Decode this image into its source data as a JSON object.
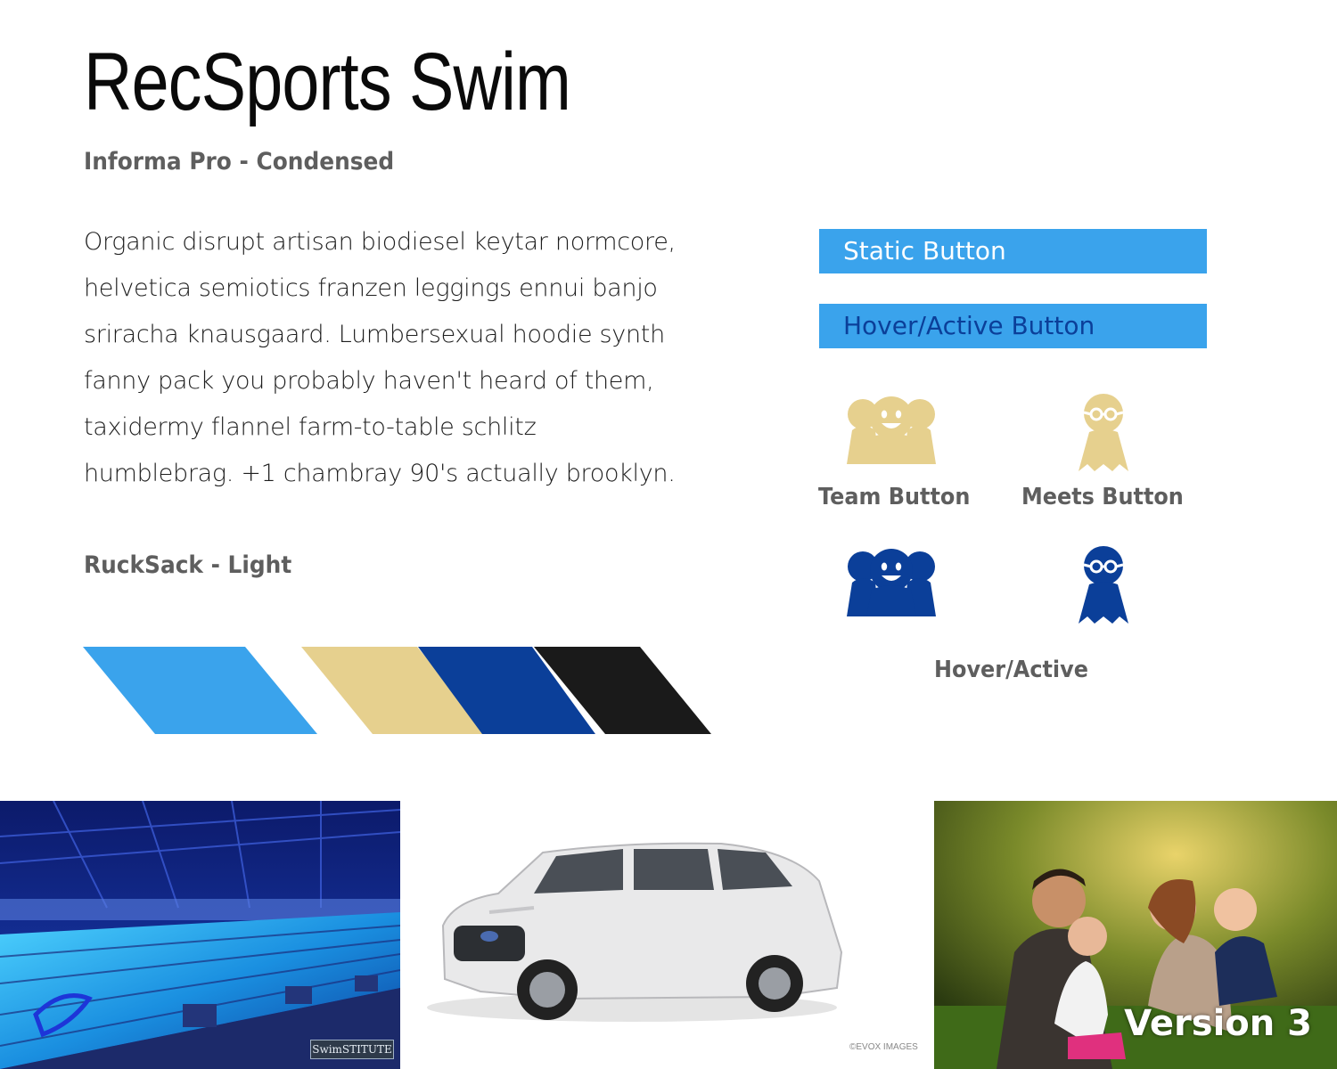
{
  "header": {
    "title": "RecSports Swim",
    "title_font_label": "Informa Pro - Condensed"
  },
  "body": {
    "lines": [
      "Organic disrupt artisan biodiesel keytar normcore,",
      "helvetica semiotics franzen leggings ennui banjo",
      "sriracha knausgaard. Lumbersexual hoodie synth",
      "fanny pack you probably haven't heard of them,",
      "taxidermy flannel farm-to-table schlitz",
      "humblebrag. +1 chambray 90's actually brooklyn."
    ],
    "body_font_label": "RuckSack - Light"
  },
  "palette": {
    "colors": [
      "#3aa3ec",
      "#e6d08e",
      "#0b3f99",
      "#1a1a1a"
    ]
  },
  "buttons": {
    "static_label": "Static Button",
    "hover_label": "Hover/Active Button",
    "static_bg": "#3aa3ec",
    "static_text_color": "#ffffff",
    "hover_text_color": "#0b3f99"
  },
  "icons": {
    "team_label": "Team Button",
    "meets_label": "Meets Button",
    "hover_label": "Hover/Active",
    "static_color": "#e6d08e",
    "hover_color": "#0b3f99"
  },
  "photos": {
    "pool_badge": "SwimSTITUTE",
    "car_credit": "©EVOX IMAGES",
    "version_label": "Version 3"
  }
}
